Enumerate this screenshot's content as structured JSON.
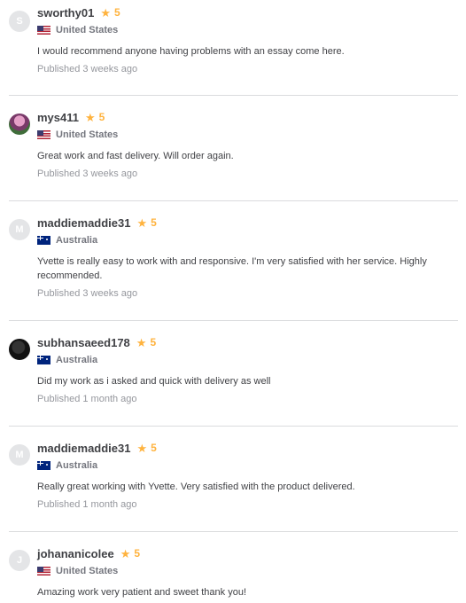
{
  "reviews": [
    {
      "avatar_letter": "S",
      "username": "sworthy01",
      "rating": "5",
      "country": "United States",
      "flag": "us",
      "text": "I would recommend anyone having problems with an essay come here.",
      "published": "Published 3 weeks ago"
    },
    {
      "avatar_letter": "",
      "username": "mys411",
      "rating": "5",
      "country": "United States",
      "flag": "us",
      "text": "Great work and fast delivery. Will order again.",
      "published": "Published 3 weeks ago"
    },
    {
      "avatar_letter": "M",
      "username": "maddiemaddie31",
      "rating": "5",
      "country": "Australia",
      "flag": "au",
      "text": "Yvette is really easy to work with and responsive. I'm very satisfied with her service. Highly recommended.",
      "published": "Published 3 weeks ago"
    },
    {
      "avatar_letter": "",
      "username": "subhansaeed178",
      "rating": "5",
      "country": "Australia",
      "flag": "au",
      "text": "Did my work as i asked and quick with delivery as well",
      "published": "Published 1 month ago"
    },
    {
      "avatar_letter": "M",
      "username": "maddiemaddie31",
      "rating": "5",
      "country": "Australia",
      "flag": "au",
      "text": "Really great working with Yvette. Very satisfied with the product delivered.",
      "published": "Published 1 month ago"
    },
    {
      "avatar_letter": "J",
      "username": "johananicolee",
      "rating": "5",
      "country": "United States",
      "flag": "us",
      "text": "Amazing work very patient and sweet thank you!",
      "published": ""
    }
  ],
  "colors": {
    "star": "#ffb33e",
    "username": "#404145",
    "meta": "#95979d",
    "divider": "#dadbdd"
  },
  "icons": {
    "star": "star-icon"
  }
}
